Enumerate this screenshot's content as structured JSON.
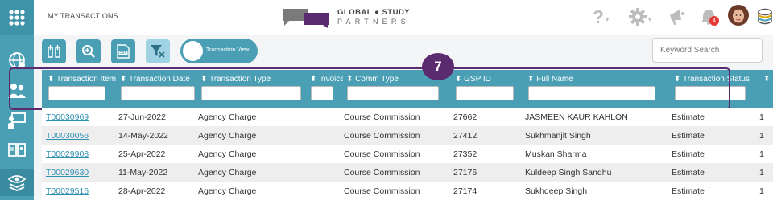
{
  "header": {
    "title": "MY TRANSACTIONS",
    "logo_line1": "GLOBAL ● STUDY",
    "logo_line2": "PARTNERS",
    "notification_count": "4",
    "help_symbol": "?"
  },
  "sidebar": {
    "items": [
      {
        "icon": "apps-grid-icon"
      },
      {
        "icon": "globe-gear-icon"
      },
      {
        "icon": "users-icon"
      },
      {
        "icon": "teacher-board-icon"
      },
      {
        "icon": "book-person-icon"
      },
      {
        "icon": "eye-layers-icon"
      }
    ]
  },
  "toolbar": {
    "buttons": [
      {
        "icon": "columns-icon"
      },
      {
        "icon": "zoom-icon"
      },
      {
        "icon": "csv-icon"
      },
      {
        "icon": "filter-clear-icon"
      }
    ],
    "toggle_label": "Transaction View",
    "search_placeholder": "Keyword Search"
  },
  "annotation": {
    "badge": "7"
  },
  "table": {
    "columns": [
      "⬍ Transaction Item",
      "⬍ Transaction Date",
      "⬍ Transaction Type",
      "⬍ Invoice",
      "⬍ Comm Type",
      "⬍ GSP ID",
      "⬍ Full Name",
      "⬍ Transaction Status",
      "⬍"
    ],
    "rows": [
      {
        "item": "T00030969",
        "date": "27-Jun-2022",
        "type": "Agency Charge",
        "invoice": "",
        "comm": "Course Commission",
        "gsp": "27662",
        "name": "JASMEEN KAUR KAHLON",
        "status": "Estimate",
        "extra": "1"
      },
      {
        "item": "T00030056",
        "date": "14-May-2022",
        "type": "Agency Charge",
        "invoice": "",
        "comm": "Course Commission",
        "gsp": "27412",
        "name": "Sukhmanjit Singh",
        "status": "Estimate",
        "extra": "1"
      },
      {
        "item": "T00029908",
        "date": "25-Apr-2022",
        "type": "Agency Charge",
        "invoice": "",
        "comm": "Course Commission",
        "gsp": "27352",
        "name": "Muskan Sharma",
        "status": "Estimate",
        "extra": "1"
      },
      {
        "item": "T00029630",
        "date": "11-May-2022",
        "type": "Agency Charge",
        "invoice": "",
        "comm": "Course Commission",
        "gsp": "27176",
        "name": "Kuldeep Singh Sandhu",
        "status": "Estimate",
        "extra": "1"
      },
      {
        "item": "T00029516",
        "date": "28-Apr-2022",
        "type": "Agency Charge",
        "invoice": "",
        "comm": "Course Commission",
        "gsp": "27174",
        "name": "Sukhdeep Singh",
        "status": "Estimate",
        "extra": "1"
      }
    ]
  },
  "colors": {
    "primary": "#4a9fb5",
    "annotation": "#5a2b6e",
    "link": "#2f8fb3",
    "notification": "#e53935"
  }
}
